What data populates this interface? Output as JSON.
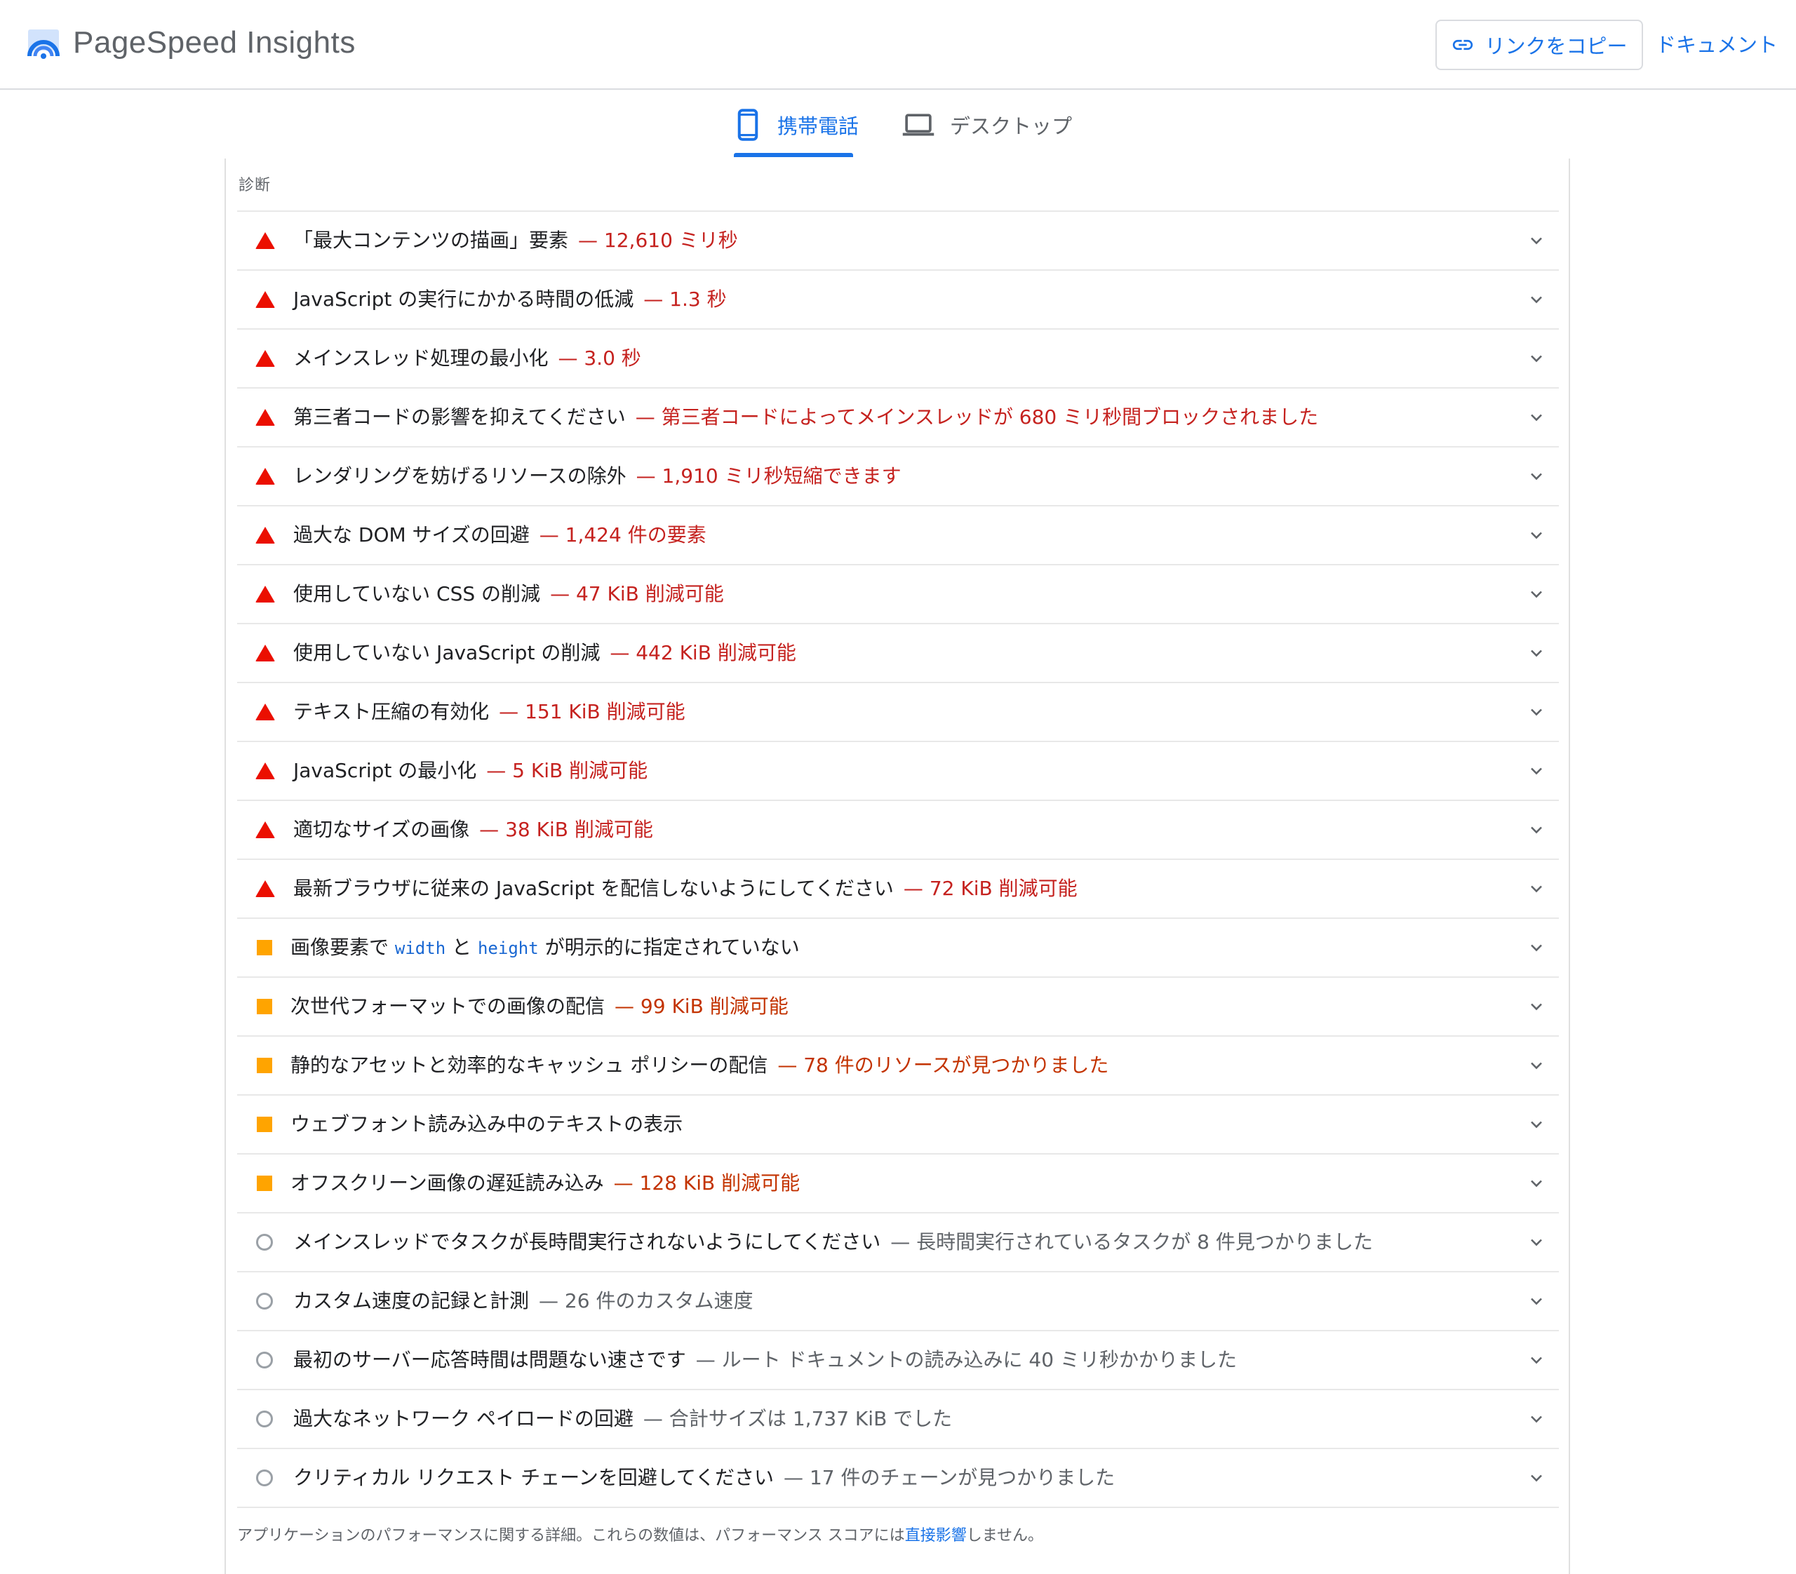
{
  "header": {
    "app_title": "PageSpeed Insights",
    "copy_link_label": "リンクをコピー",
    "docs_label": "ドキュメント"
  },
  "tabs": [
    {
      "label": "携帯電話",
      "icon": "smartphone-icon",
      "selected": true
    },
    {
      "label": "デスクトップ",
      "icon": "laptop-icon",
      "selected": false
    }
  ],
  "section": {
    "title": "診断",
    "audits": [
      {
        "status": "fail",
        "title": "「最大コンテンツの描画」要素",
        "detail": "— 12,610 ミリ秒"
      },
      {
        "status": "fail",
        "title": "JavaScript の実行にかかる時間の低減",
        "detail": "— 1.3 秒"
      },
      {
        "status": "fail",
        "title": "メインスレッド処理の最小化",
        "detail": "— 3.0 秒"
      },
      {
        "status": "fail",
        "title": "第三者コードの影響を抑えてください",
        "detail": "— 第三者コードによってメインスレッドが 680 ミリ秒間ブロックされました"
      },
      {
        "status": "fail",
        "title": "レンダリングを妨げるリソースの除外",
        "detail": "— 1,910 ミリ秒短縮できます"
      },
      {
        "status": "fail",
        "title": "過大な DOM サイズの回避",
        "detail": "— 1,424 件の要素"
      },
      {
        "status": "fail",
        "title": "使用していない CSS の削減",
        "detail": "— 47 KiB 削減可能"
      },
      {
        "status": "fail",
        "title": "使用していない JavaScript の削減",
        "detail": "— 442 KiB 削減可能"
      },
      {
        "status": "fail",
        "title": "テキスト圧縮の有効化",
        "detail": "— 151 KiB 削減可能"
      },
      {
        "status": "fail",
        "title": "JavaScript の最小化",
        "detail": "— 5 KiB 削減可能"
      },
      {
        "status": "fail",
        "title": "適切なサイズの画像",
        "detail": "— 38 KiB 削減可能"
      },
      {
        "status": "fail",
        "title": "最新ブラウザに従来の JavaScript を配信しないようにしてください",
        "detail": "— 72 KiB 削減可能"
      },
      {
        "status": "average",
        "title_parts": [
          "画像要素で ",
          "width",
          " と ",
          "height",
          " が明示的に指定されていない"
        ],
        "detail": ""
      },
      {
        "status": "average",
        "title": "次世代フォーマットでの画像の配信",
        "detail": "— 99 KiB 削減可能"
      },
      {
        "status": "average",
        "title": "静的なアセットと効率的なキャッシュ ポリシーの配信",
        "detail": "— 78 件のリソースが見つかりました"
      },
      {
        "status": "average",
        "title": "ウェブフォント読み込み中のテキストの表示",
        "detail": ""
      },
      {
        "status": "average",
        "title": "オフスクリーン画像の遅延読み込み",
        "detail": "— 128 KiB 削減可能"
      },
      {
        "status": "informative",
        "title": "メインスレッドでタスクが長時間実行されないようにしてください",
        "detail": "— 長時間実行されているタスクが 8 件見つかりました"
      },
      {
        "status": "informative",
        "title": "カスタム速度の記録と計測",
        "detail": "— 26 件のカスタム速度"
      },
      {
        "status": "informative",
        "title": "最初のサーバー応答時間は問題ない速さです",
        "detail": "— ルート ドキュメントの読み込みに 40 ミリ秒かかりました"
      },
      {
        "status": "informative",
        "title": "過大なネットワーク ペイロードの回避",
        "detail": "— 合計サイズは 1,737 KiB でした"
      },
      {
        "status": "informative",
        "title": "クリティカル リクエスト チェーンを回避してください",
        "detail": "— 17 件のチェーンが見つかりました"
      }
    ],
    "footer": {
      "before": "アプリケーションのパフォーマンスに関する詳細。これらの数値は、パフォーマンス スコアには",
      "link": "直接影響",
      "after": "しません。"
    }
  },
  "colors": {
    "accent": "#1a73e8",
    "fail": "#eb0f00",
    "fail_text": "#c5221f",
    "average": "#ffa400",
    "average_text": "#c33300",
    "informative": "#9aa0a6"
  }
}
